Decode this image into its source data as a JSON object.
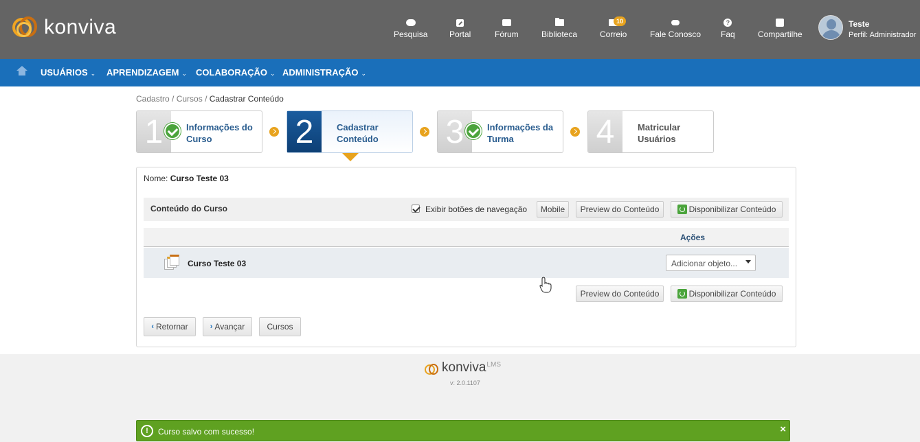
{
  "header": {
    "logo_text": "konviva",
    "nav": [
      {
        "label": "Pesquisa",
        "icon": "chat-icon"
      },
      {
        "label": "Portal",
        "icon": "external-link-icon"
      },
      {
        "label": "Fórum",
        "icon": "forum-icon"
      },
      {
        "label": "Biblioteca",
        "icon": "folder-icon"
      },
      {
        "label": "Correio",
        "icon": "mail-icon",
        "badge": "10"
      },
      {
        "label": "Fale Conosco",
        "icon": "cloud-upload-icon"
      },
      {
        "label": "Faq",
        "icon": "help-icon"
      },
      {
        "label": "Compartilhe",
        "icon": "share-icon"
      }
    ],
    "user": {
      "name": "Teste",
      "profile": "Perfil: Administrador"
    }
  },
  "menu": {
    "items": [
      {
        "label": "USUÁRIOS"
      },
      {
        "label": "APRENDIZAGEM"
      },
      {
        "label": "COLABORAÇÃO"
      },
      {
        "label": "ADMINISTRAÇÃO"
      }
    ],
    "caret": "⌄"
  },
  "breadcrumb": {
    "items": [
      "Cadastro",
      "Cursos"
    ],
    "separator": " / ",
    "current": "Cadastrar Conteúdo"
  },
  "wizard": {
    "steps": [
      {
        "number": "1",
        "label": "Informações do Curso",
        "status": "done"
      },
      {
        "number": "2",
        "label": "Cadastrar Conteúdo",
        "status": "active"
      },
      {
        "number": "3",
        "label": "Informações da Turma",
        "status": "done"
      },
      {
        "number": "4",
        "label": "Matricular Usuários",
        "status": "pending"
      }
    ]
  },
  "course": {
    "name_label": "Nome:",
    "name_value": "Curso Teste 03"
  },
  "content": {
    "title": "Conteúdo do Curso",
    "show_nav_buttons_label": "Exibir botões de navegação",
    "show_nav_buttons_checked": true,
    "mobile_button": "Mobile",
    "preview_button": "Preview do Conteúdo",
    "publish_button": "Disponibilizar Conteúdo",
    "table": {
      "actions_header": "Ações",
      "rows": [
        {
          "name": "Curso Teste 03",
          "action_placeholder": "Adicionar objeto..."
        }
      ]
    }
  },
  "footer_nav": {
    "back": "Retornar",
    "next": "Avançar",
    "courses": "Cursos"
  },
  "footer": {
    "logo_text": "konviva",
    "logo_sup": "LMS",
    "version": "v: 2.0.1107"
  },
  "toast": {
    "icon": "!",
    "message": "Curso salvo com sucesso!",
    "close": "×"
  },
  "colors": {
    "header_bg": "#646464",
    "menu_bg": "#1a6fba",
    "accent": "#e8a31e",
    "success": "#5fa121"
  }
}
